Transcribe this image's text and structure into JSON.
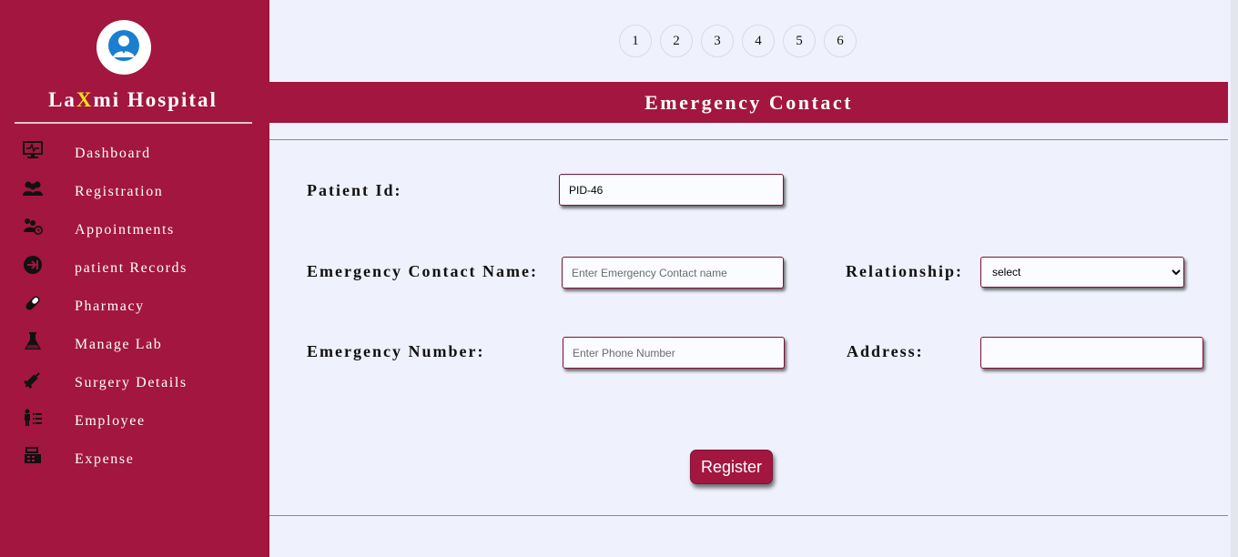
{
  "sidebar": {
    "brand": {
      "part1": "La",
      "highlight": "X",
      "part2": "mi Hospital"
    },
    "logo_icon": "doctor-icon",
    "items": [
      {
        "label": "Dashboard",
        "icon": "monitor-icon"
      },
      {
        "label": "Registration",
        "icon": "users-icon"
      },
      {
        "label": "Appointments",
        "icon": "user-clock-icon"
      },
      {
        "label": "patient Records",
        "icon": "sign-in-icon"
      },
      {
        "label": "Pharmacy",
        "icon": "capsule-icon"
      },
      {
        "label": "Manage Lab",
        "icon": "flask-icon"
      },
      {
        "label": "Surgery Details",
        "icon": "syringe-icon"
      },
      {
        "label": "Employee",
        "icon": "employee-list-icon"
      },
      {
        "label": "Expense",
        "icon": "cash-register-icon"
      }
    ]
  },
  "steps": [
    "1",
    "2",
    "3",
    "4",
    "5",
    "6"
  ],
  "header": {
    "title": "Emergency Contact"
  },
  "form": {
    "patient_id_label": "Patient Id:",
    "patient_id_value": "PID-46",
    "contact_name_label": "Emergency Contact Name:",
    "contact_name_placeholder": "Enter Emergency Contact name",
    "relationship_label": "Relationship:",
    "relationship_selected": "select",
    "number_label": "Emergency Number:",
    "number_placeholder": "Enter Phone Number",
    "address_label": "Address:",
    "address_value": "",
    "register_label": "Register"
  },
  "colors": {
    "sidebar_bg": "#a2163f",
    "brand_highlight": "#f5e11a",
    "page_bg": "#eff1fc"
  }
}
